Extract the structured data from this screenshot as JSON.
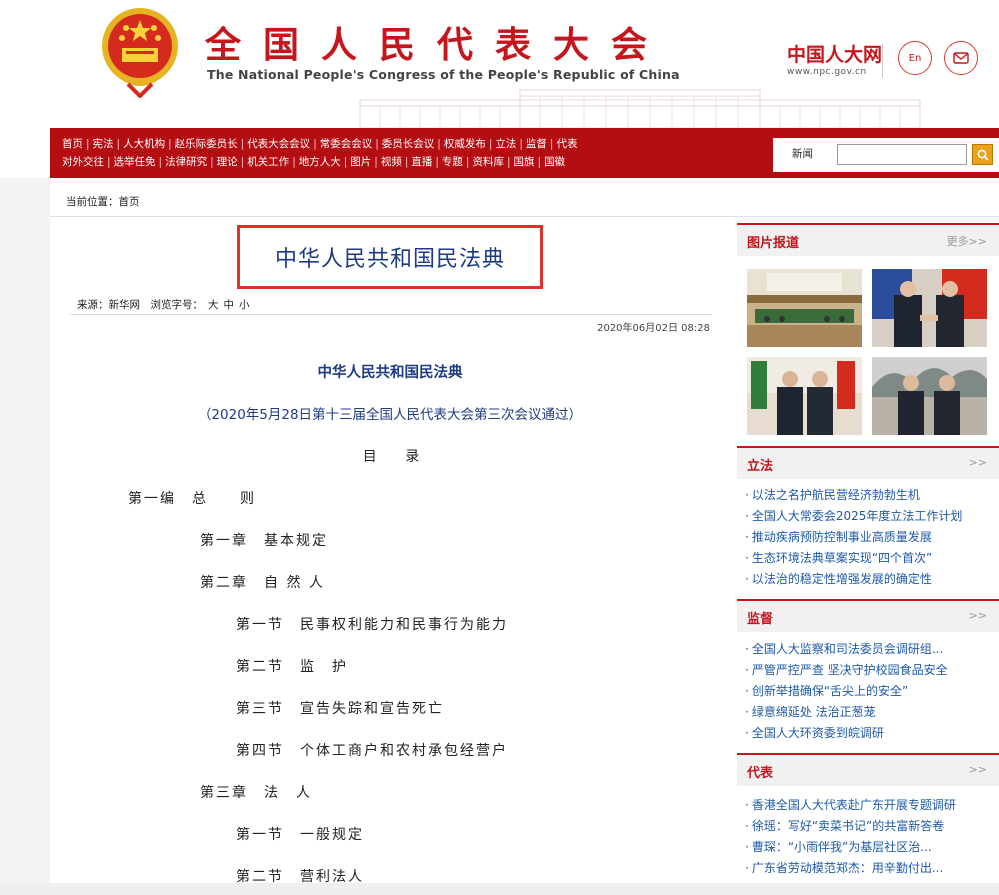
{
  "header": {
    "title_cn": "全国人民代表大会",
    "title_en": "The National People's Congress of the People's Republic of China",
    "logo_cn": "中国人大网",
    "logo_url": "www.npc.gov.cn",
    "en_button": "En",
    "mail_icon": "mail-icon",
    "emblem_icon": "national-emblem-icon",
    "brand_color": "#c4161c"
  },
  "nav": {
    "row1": [
      "首页",
      "宪法",
      "人大机构",
      "赵乐际委员长",
      "代表大会会议",
      "常委会会议",
      "委员长会议",
      "权威发布",
      "立法",
      "监督",
      "代表"
    ],
    "row2": [
      "对外交往",
      "选举任免",
      "法律研究",
      "理论",
      "机关工作",
      "地方人大",
      "图片",
      "视频",
      "直播",
      "专题",
      "资料库",
      "国旗",
      "国徽"
    ],
    "search_label": "新闻",
    "search_value": "",
    "search_icon": "search-icon",
    "bar_color": "#b40e13"
  },
  "breadcrumb": "当前位置：首页",
  "article": {
    "title": "中华人民共和国民法典",
    "source_label": "来源：",
    "source": "新华网",
    "font_size_label": "浏览字号：",
    "font_sizes": [
      "大",
      "中",
      "小"
    ],
    "date": "2020年06月02日  08:28",
    "content_title": "中华人民共和国民法典",
    "content_sub": "（2020年5月28日第十三届全国人民代表大会第三次会议通过）",
    "toc_heading": "目 录",
    "toc": [
      "第一编　总　　则",
      "第一章　基本规定",
      "第二章　自 然 人",
      "第一节　民事权利能力和民事行为能力",
      "第二节　监　护",
      "第三节　宣告失踪和宣告死亡",
      "第四节　个体工商户和农村承包经营户",
      "第三章　法　人",
      "第一节　一般规定",
      "第二节　营利法人"
    ]
  },
  "sidebar": {
    "photo": {
      "label": "图片报道",
      "more": "更多>>"
    },
    "legislation": {
      "label": "立法",
      "more": ">>",
      "items": [
        "以法之名护航民营经济勃勃生机",
        "全国人大常委会2025年度立法工作计划",
        "推动疾病预防控制事业高质量发展",
        "生态环境法典草案实现“四个首次”",
        "以法治的稳定性增强发展的确定性"
      ]
    },
    "supervision": {
      "label": "监督",
      "more": ">>",
      "items": [
        "全国人大监察和司法委员会调研组...",
        "严管严控严查 坚决守护校园食品安全",
        "创新举措确保“舌尖上的安全”",
        "绿意绵延处 法治正葱茏",
        "全国人大环资委到皖调研"
      ]
    },
    "deputies": {
      "label": "代表",
      "more": ">>",
      "items": [
        "香港全国人大代表赴广东开展专题调研",
        "徐瑶：写好“卖菜书记”的共富新答卷",
        "曹琛：“小雨伴我”为基层社区治...",
        "广东省劳动模范郑杰：用辛勤付出..."
      ]
    }
  }
}
